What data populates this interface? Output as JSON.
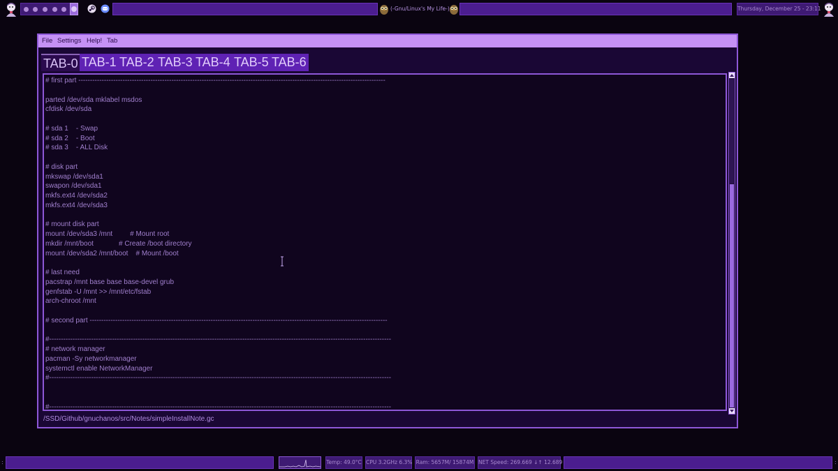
{
  "top_panel": {
    "title": "(-Gnu/Linux's My Life-)",
    "clock": "Thursday, December 25 - 23:11",
    "workspaces": {
      "count": 6,
      "active": 6
    },
    "icons": [
      "user-avatar",
      "steam-icon",
      "discord-icon",
      "owl-icon",
      "owl-icon",
      "user-avatar"
    ]
  },
  "menubar": {
    "file": "File",
    "settings": "Settings",
    "help": "Help!",
    "tab": "Tab"
  },
  "tabs": [
    {
      "label": "TAB-0",
      "active": true
    },
    {
      "label": "TAB-1",
      "active": false
    },
    {
      "label": "TAB-2",
      "active": false
    },
    {
      "label": "TAB-3",
      "active": false
    },
    {
      "label": "TAB-4",
      "active": false
    },
    {
      "label": "TAB-5",
      "active": false
    },
    {
      "label": "TAB-6",
      "active": false
    }
  ],
  "editor": {
    "lines": [
      "# first part ------------------------------------------------------------------------------------------------------------------------------------",
      "",
      "parted /dev/sda mklabel msdos",
      "cfdisk /dev/sda",
      "",
      "# sda 1    - Swap",
      "# sda 2    - Boot",
      "# sda 3    - ALL Disk",
      "",
      "# disk part",
      "mkswap /dev/sda1",
      "swapon /dev/sda1",
      "mkfs.ext4 /dev/sda2",
      "mkfs.ext4 /dev/sda3",
      "",
      "# mount disk part",
      "mount /dev/sda3 /mnt         # Mount root",
      "mkdir /mnt/boot             # Create /boot directory",
      "mount /dev/sda2 /mnt/boot    # Mount /boot",
      "",
      "# last need",
      "pacstrap /mnt base base base-devel grub",
      "genfstab -U /mnt >> /mnt/etc/fstab",
      "arch-chroot /mnt",
      "",
      "# second part --------------------------------------------------------------------------------------------------------------------------------",
      "",
      "#---------------------------------------------------------------------------------------------------------------------------------------------------",
      "# network manager",
      "pacman -Sy networkmanager",
      "systemctl enable NetworkManager",
      "#---------------------------------------------------------------------------------------------------------------------------------------------------",
      "",
      "",
      "#---------------------------------------------------------------------------------------------------------------------------------------------------"
    ]
  },
  "statusbar": {
    "path": "/SSD/Github/gnuchanos/src/Notes/simpleInstallNote.gc"
  },
  "bottom_panel": {
    "temp": "Temp: 49.0°C",
    "cpu": "CPU 3.2GHz 6.3%",
    "ram": "Ram:  5657M/ 15874M",
    "net": "NET Speed: 269.669 ↓↑ 12.689"
  },
  "colors": {
    "accent": "#8e58d8",
    "menubar": "#c591f5",
    "panel": "#4b1d8f",
    "editor_bg": "#10051e",
    "text": "#a07fcd"
  }
}
